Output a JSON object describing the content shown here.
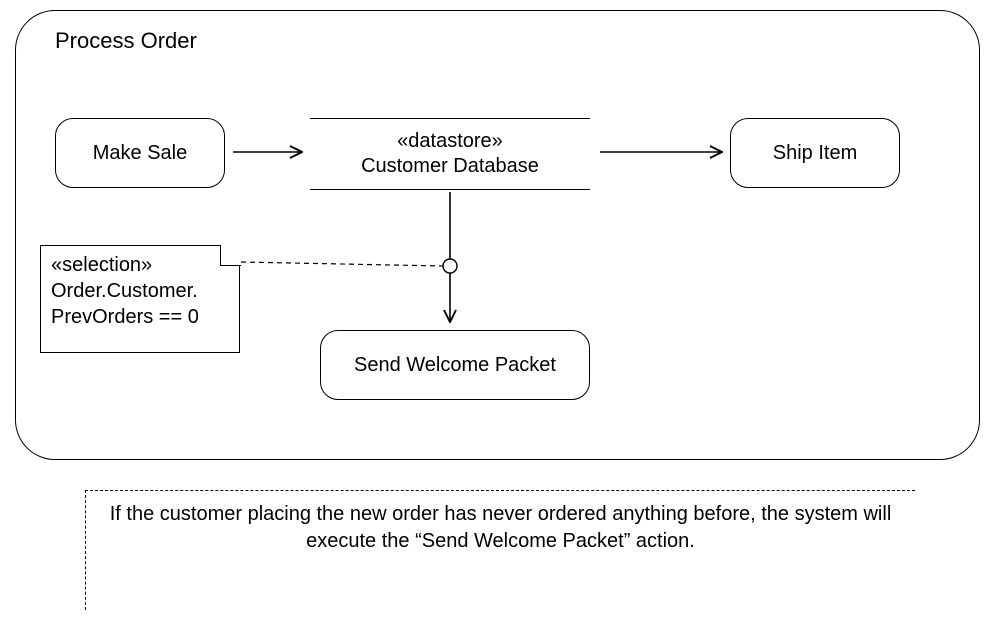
{
  "diagram": {
    "title": "Process Order",
    "nodes": {
      "make_sale": "Make Sale",
      "datastore_stereotype": "«datastore»",
      "datastore_name": "Customer Database",
      "ship_item": "Ship Item",
      "send_welcome": "Send Welcome Packet"
    },
    "note": {
      "stereotype": "«selection»",
      "line2": "Order.Customer.",
      "line3": "PrevOrders == 0"
    },
    "explanation": "If the customer placing the new order has never ordered anything before, the system will execute the “Send Welcome Packet” action."
  }
}
